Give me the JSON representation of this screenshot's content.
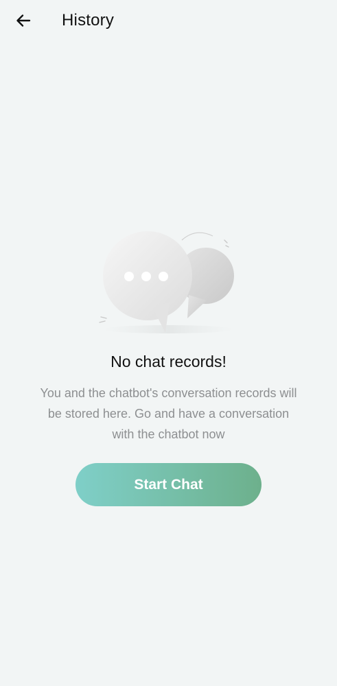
{
  "header": {
    "back_icon": "arrow-left-icon",
    "title": "History"
  },
  "empty_state": {
    "illustration_icon": "chat-bubbles-icon",
    "title": "No chat records!",
    "description": "You and the chatbot's conversation records will be stored here. Go and have a conversation with the chatbot now",
    "button_label": "Start Chat"
  },
  "colors": {
    "background": "#f2f5f5",
    "button_gradient_start": "#7fcfc8",
    "button_gradient_end": "#6db08c",
    "description_text": "#8d8f91"
  }
}
